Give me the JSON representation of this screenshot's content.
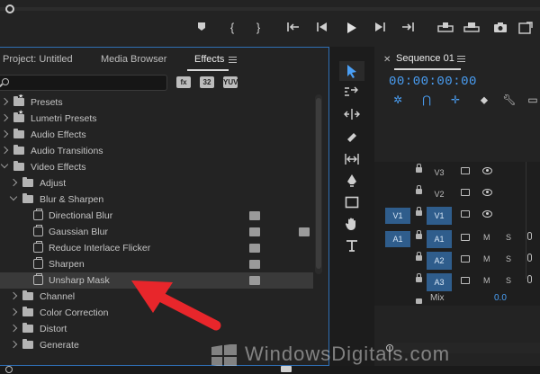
{
  "transport": {
    "buttons": [
      "marker",
      "in-point",
      "out-point",
      "go-to-in",
      "step-back",
      "play",
      "step-forward",
      "go-to-out",
      "insert",
      "overwrite",
      "export-frame",
      "button-editor"
    ]
  },
  "project_panel": {
    "tabs": [
      {
        "label": "Project: Untitled",
        "active": false
      },
      {
        "label": "Media Browser",
        "active": false
      },
      {
        "label": "Effects",
        "active": true
      }
    ],
    "search": {
      "value": "",
      "placeholder": ""
    },
    "filter_badges": [
      "fx",
      "32",
      "YUV"
    ],
    "tree": [
      {
        "label": "Presets",
        "level": 0,
        "expanded": false,
        "type": "star-folder"
      },
      {
        "label": "Lumetri Presets",
        "level": 0,
        "expanded": false,
        "type": "star-folder"
      },
      {
        "label": "Audio Effects",
        "level": 0,
        "expanded": false,
        "type": "folder"
      },
      {
        "label": "Audio Transitions",
        "level": 0,
        "expanded": false,
        "type": "folder"
      },
      {
        "label": "Video Effects",
        "level": 0,
        "expanded": true,
        "type": "folder"
      },
      {
        "label": "Adjust",
        "level": 1,
        "expanded": false,
        "type": "folder"
      },
      {
        "label": "Blur & Sharpen",
        "level": 1,
        "expanded": true,
        "type": "folder"
      },
      {
        "label": "Directional Blur",
        "level": 2,
        "type": "effect",
        "accelerated": true,
        "yuv": false
      },
      {
        "label": "Gaussian Blur",
        "level": 2,
        "type": "effect",
        "accelerated": true,
        "yuv": true
      },
      {
        "label": "Reduce Interlace Flicker",
        "level": 2,
        "type": "effect",
        "accelerated": true,
        "yuv": false
      },
      {
        "label": "Sharpen",
        "level": 2,
        "type": "effect",
        "accelerated": true,
        "yuv": false
      },
      {
        "label": "Unsharp Mask",
        "level": 2,
        "type": "effect",
        "accelerated": true,
        "yuv": false,
        "selected": true
      },
      {
        "label": "Channel",
        "level": 1,
        "expanded": false,
        "type": "folder"
      },
      {
        "label": "Color Correction",
        "level": 1,
        "expanded": false,
        "type": "folder"
      },
      {
        "label": "Distort",
        "level": 1,
        "expanded": false,
        "type": "folder"
      },
      {
        "label": "Generate",
        "level": 1,
        "expanded": false,
        "type": "folder"
      }
    ]
  },
  "tools": [
    "selection-tool",
    "track-select-tool",
    "ripple-edit-tool",
    "razor-tool",
    "slip-tool",
    "pen-tool",
    "rectangle-tool",
    "hand-tool",
    "type-tool"
  ],
  "sequence_panel": {
    "title": "Sequence 01",
    "timecode": "00:00:00:00",
    "tracks": [
      {
        "source": "",
        "target": "V3",
        "kind": "video",
        "target_on": false
      },
      {
        "source": "",
        "target": "V2",
        "kind": "video",
        "target_on": false
      },
      {
        "source": "V1",
        "target": "V1",
        "kind": "video",
        "target_on": true
      },
      {
        "source": "A1",
        "target": "A1",
        "kind": "audio",
        "target_on": true
      },
      {
        "source": "",
        "target": "A2",
        "kind": "audio",
        "target_on": true
      },
      {
        "source": "",
        "target": "A3",
        "kind": "audio",
        "target_on": true
      }
    ],
    "mute_label": "M",
    "solo_label": "S",
    "mix_label": "Mix",
    "mix_value": "0.0"
  },
  "watermark": {
    "text": "WindowsDigitals.com"
  },
  "colors": {
    "accent": "#4a9ff5",
    "panel_border": "#2f6fb5",
    "arrow": "#e8262b",
    "track_on": "#2f5d8c"
  }
}
